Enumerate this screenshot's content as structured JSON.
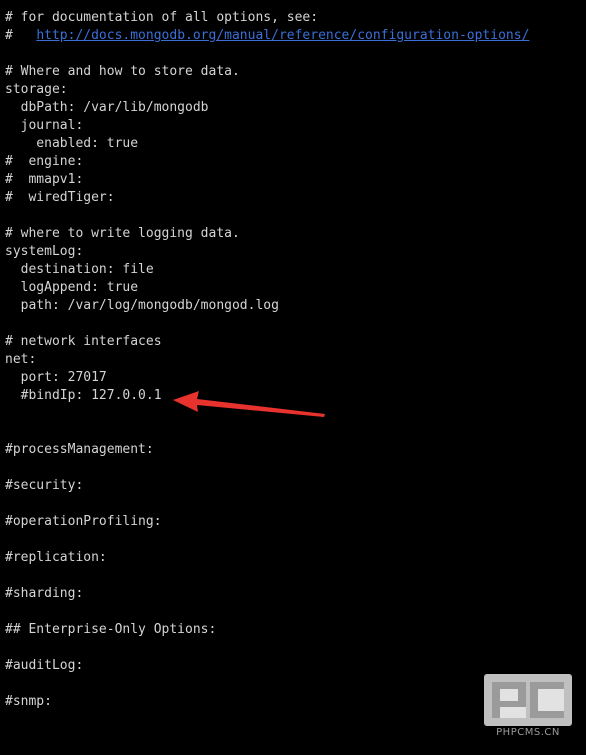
{
  "terminal": {
    "lines": [
      "# for documentation of all options, see:",
      "#   ",
      "",
      "# Where and how to store data.",
      "storage:",
      "  dbPath: /var/lib/mongodb",
      "  journal:",
      "    enabled: true",
      "#  engine:",
      "#  mmapv1:",
      "#  wiredTiger:",
      "",
      "# where to write logging data.",
      "systemLog:",
      "  destination: file",
      "  logAppend: true",
      "  path: /var/log/mongodb/mongod.log",
      "",
      "# network interfaces",
      "net:",
      "  port: 27017",
      "  #bindIp: 127.0.0.1",
      "",
      "",
      "#processManagement:",
      "",
      "#security:",
      "",
      "#operationProfiling:",
      "",
      "#replication:",
      "",
      "#sharding:",
      "",
      "## Enterprise-Only Options:",
      "",
      "#auditLog:",
      "",
      "#snmp:"
    ],
    "doc_link": "http://docs.mongodb.org/manual/reference/configuration-options/"
  },
  "annotation": {
    "arrow_color": "#e8322d"
  },
  "watermark": {
    "logo_text": "PC",
    "site": "PHPCMS.CN"
  }
}
